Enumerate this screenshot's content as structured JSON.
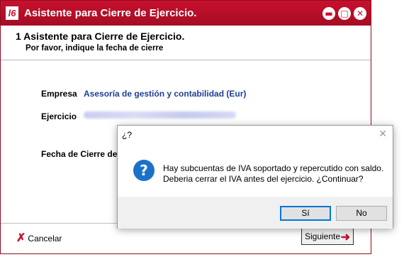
{
  "window": {
    "app_icon_text": "l6",
    "title": "Asistente para Cierre de Ejercicio.",
    "min_glyph": "▬",
    "max_glyph": "□",
    "close_glyph": "✕"
  },
  "header": {
    "title": "1 Asistente para Cierre de Ejercicio.",
    "subtitle": "Por favor, indique la fecha de cierre"
  },
  "form": {
    "empresa_label": "Empresa",
    "empresa_value": "Asesoría de gestión y contabilidad (Eur)",
    "ejercicio_label": "Ejercicio",
    "fecha_label": "Fecha de Cierre del"
  },
  "footer": {
    "cancel_label": "Cancelar",
    "next_label": "Siguiente"
  },
  "dialog": {
    "title": "¿?",
    "message_line1": "Hay subcuentas de IVA soportado y repercutido con saldo.",
    "message_line2": "Deberia cerrar el IVA antes del ejercicio. ¿Continuar?",
    "yes_label": "Sí",
    "no_label": "No"
  }
}
